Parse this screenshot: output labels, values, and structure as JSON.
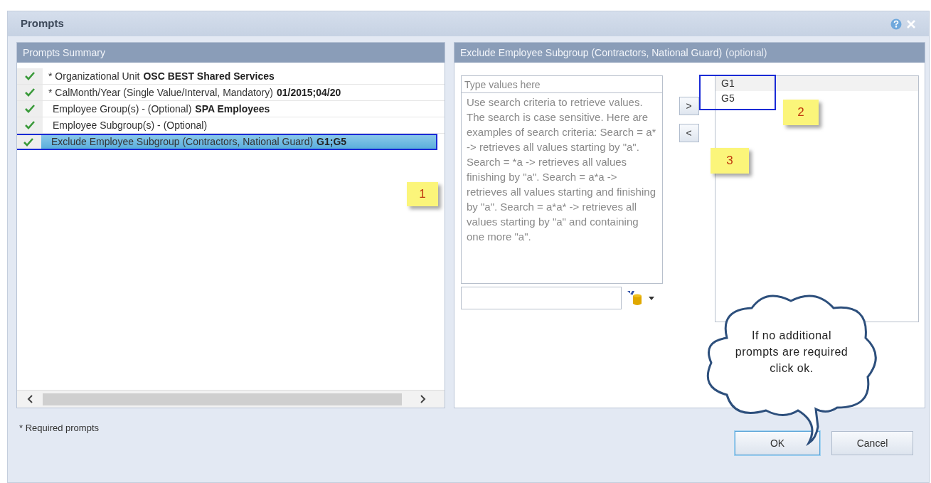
{
  "window": {
    "title": "Prompts"
  },
  "summary": {
    "title": "Prompts Summary",
    "items": [
      {
        "label": "* Organizational Unit",
        "value": "OSC BEST Shared Services",
        "checked": true,
        "selected": false
      },
      {
        "label": "* CalMonth/Year (Single Value/Interval, Mandatory)",
        "value": "01/2015;04/20",
        "checked": true,
        "selected": false
      },
      {
        "label": "Employee Group(s) - (Optional)",
        "value": "SPA Employees",
        "checked": true,
        "selected": false
      },
      {
        "label": "Employee Subgroup(s) - (Optional)",
        "checked": true,
        "selected": false
      },
      {
        "label": "Exclude Employee Subgroup (Contractors, National Guard)",
        "value": "G1;G5",
        "checked": true,
        "selected": true
      }
    ]
  },
  "detail": {
    "title": "Exclude Employee Subgroup (Contractors, National Guard)",
    "hint": "(optional)",
    "search": {
      "placeholder": "Type values here"
    },
    "help": "Use search criteria to retrieve values. The search is case sensitive. Here are examples of search criteria: Search = a* -> retrieves all values starting by \"a\". Search = *a -> retrieves all values finishing by \"a\". Search = a*a -> retrieves all values starting and finishing by \"a\". Search = a*a* -> retrieves all values starting by \"a\" and containing one more \"a\".",
    "add": ">",
    "remove": "<",
    "selected_values": [
      "G1",
      "G5"
    ]
  },
  "annotations": {
    "notes": [
      "1",
      "2",
      "3"
    ],
    "callout": "If no additional prompts are required click ok."
  },
  "footer": {
    "note": "* Required prompts",
    "buttons": [
      "OK",
      "Cancel"
    ]
  }
}
